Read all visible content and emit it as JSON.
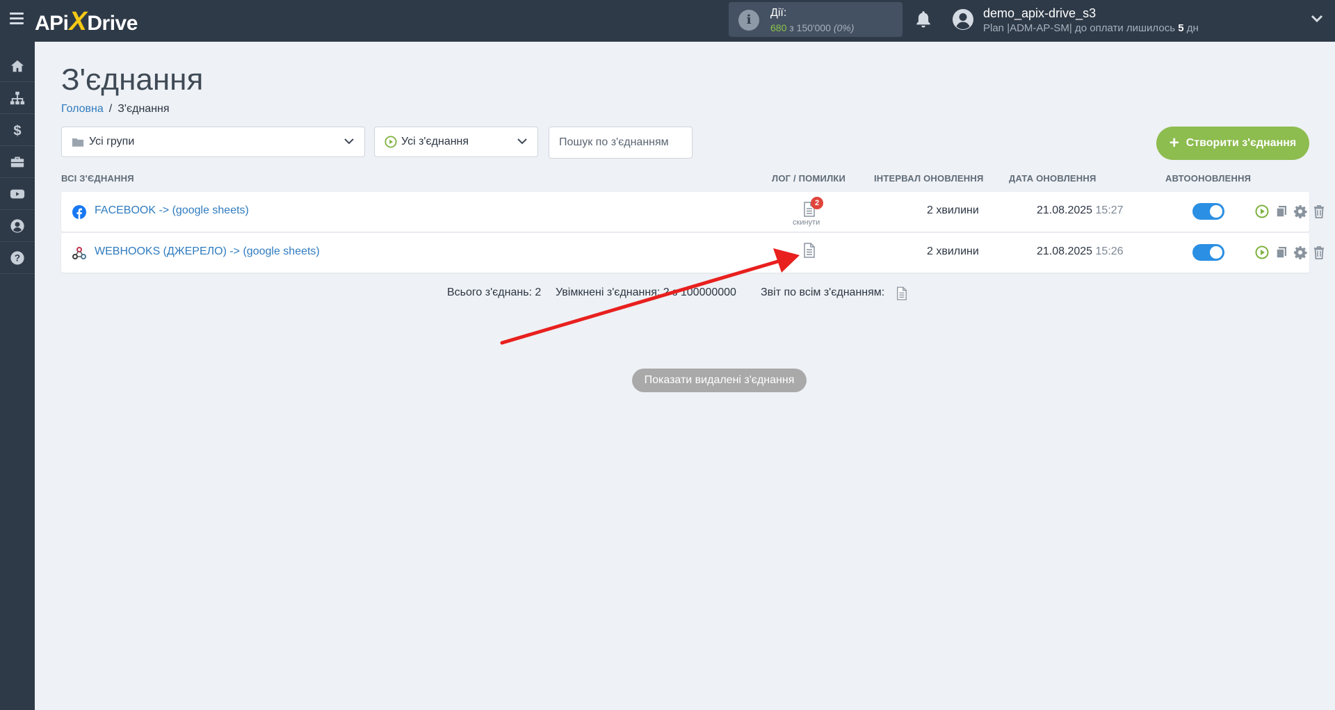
{
  "app": {
    "logo_pre": "APi",
    "logo_x": "X",
    "logo_post": "Drive"
  },
  "topbar": {
    "actions_label": "Дії:",
    "actions_used": "680",
    "actions_of": "з 150'000",
    "actions_pct": "(0%)",
    "user_name": "demo_apix-drive_s3",
    "plan_text": "Plan |ADM-AP-SM| до оплати лишилось",
    "plan_days": "5",
    "plan_days_unit": "дн"
  },
  "sidebar": {
    "items": [
      {
        "icon": "home-icon"
      },
      {
        "icon": "sitemap-icon"
      },
      {
        "icon": "dollar-icon"
      },
      {
        "icon": "briefcase-icon"
      },
      {
        "icon": "youtube-icon"
      },
      {
        "icon": "user-circle-icon"
      },
      {
        "icon": "help-icon"
      }
    ]
  },
  "page": {
    "title": "З'єднання",
    "breadcrumb_home": "Головна",
    "breadcrumb_current": "З'єднання"
  },
  "filters": {
    "groups_value": "Усі групи",
    "connections_value": "Усі з'єднання",
    "search_placeholder": "Пошук по з'єднанням",
    "create_label": "Створити з'єднання"
  },
  "table": {
    "headers": {
      "all": "ВСІ З'ЄДНАННЯ",
      "log": "ЛОГ / ПОМИЛКИ",
      "interval": "ІНТЕРВАЛ ОНОВЛЕННЯ",
      "date": "ДАТА ОНОВЛЕННЯ",
      "auto": "АВТООНОВЛЕННЯ"
    },
    "rows": [
      {
        "source_icon": "facebook-icon",
        "name": "FACEBOOK -> (google sheets)",
        "errors": "2",
        "reset_label": "скинути",
        "interval": "2 хвилини",
        "date": "21.08.2025",
        "time": "15:27",
        "auto_update": true
      },
      {
        "source_icon": "webhooks-icon",
        "name": "WEBHOOKS (ДЖЕРЕЛО) -> (google sheets)",
        "interval": "2 хвилини",
        "date": "21.08.2025",
        "time": "15:26",
        "auto_update": true
      }
    ]
  },
  "summary": {
    "total": "Всього з'єднань: 2",
    "enabled": "Увімкнені з'єднання: 2 з 100000000",
    "report": "Звіт по всім з'єднанням:"
  },
  "show_deleted_label": "Показати видалені з'єднання",
  "colors": {
    "topbar": "#2f3a48",
    "accent_green": "#8dbc4f",
    "link_blue": "#2f7bbf",
    "toggle_blue": "#2b8fe3",
    "badge_red": "#e0443b",
    "arrow_red": "#e8201e"
  }
}
